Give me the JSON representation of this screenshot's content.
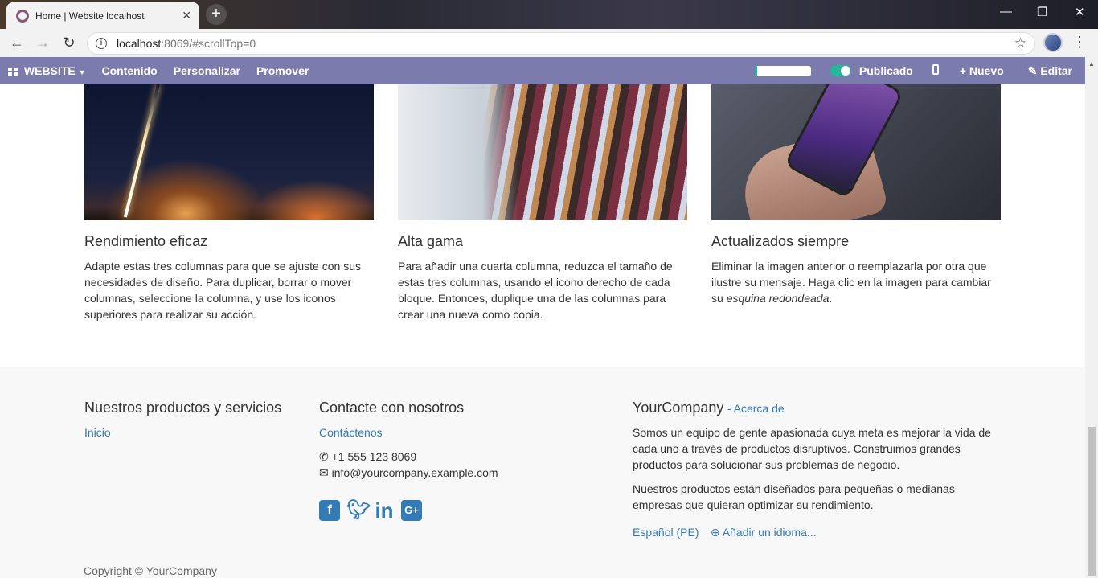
{
  "browser": {
    "tab_title": "Home | Website localhost",
    "tab_close": "✕",
    "new_tab": "+",
    "url_host": "localhost",
    "url_rest": ":8069/#scrollTop=0",
    "window_controls": [
      "—",
      "❐",
      "✕"
    ]
  },
  "odoo_bar": {
    "website_label": "WEBSITE",
    "menu": [
      "Contenido",
      "Personalizar",
      "Promover"
    ],
    "progress_fraction": 0.05,
    "published_label": "Publicado",
    "new_label": "Nuevo",
    "edit_label": "Editar"
  },
  "features": [
    {
      "image": "rocket-launch",
      "title": "Rendimiento eficaz",
      "text": "Adapte estas tres columnas para que se ajuste con sus necesidades de diseño. Para duplicar, borrar o mover columnas, seleccione la columna, y use los iconos superiores para realizar su acción."
    },
    {
      "image": "clothes-rack",
      "title": "Alta gama",
      "text": "Para añadir una cuarta columna, reduzca el tamaño de estas tres columnas, usando el icono derecho de cada bloque. Entonces, duplique una de las columnas para crear una nueva como copia."
    },
    {
      "image": "hand-phone",
      "title": "Actualizados siempre",
      "text_plain": "Eliminar la imagen anterior o reemplazarla por otra que ilustre su mensaje. Haga clic en la imagen para cambiar su ",
      "text_em": "esquina redondeada",
      "text_end": "."
    }
  ],
  "footer": {
    "products_title": "Nuestros productos y servicios",
    "products_link": "Inicio",
    "contact_title": "Contacte con nosotros",
    "contact_link": "Contáctenos",
    "phone": "+1 555 123 8069",
    "email": "info@yourcompany.example.com",
    "social": [
      "facebook",
      "twitter",
      "linkedin",
      "google-plus"
    ],
    "company_name": "YourCompany",
    "about_link": "- Acerca de",
    "about_p1": "Somos un equipo de gente apasionada cuya meta es mejorar la vida de cada uno a través de productos disruptivos. Construimos grandes productos para solucionar sus problemas de negocio.",
    "about_p2": "Nuestros productos están diseñados para pequeñas o medianas empresas que quieran optimizar su rendimiento.",
    "language": "Español (PE)",
    "add_language": "Añadir un idioma...",
    "copyright": "Copyright © YourCompany"
  },
  "colors": {
    "odoo_bar": "#7c7bad",
    "link": "#337ab7",
    "published_toggle": "#21b799"
  }
}
